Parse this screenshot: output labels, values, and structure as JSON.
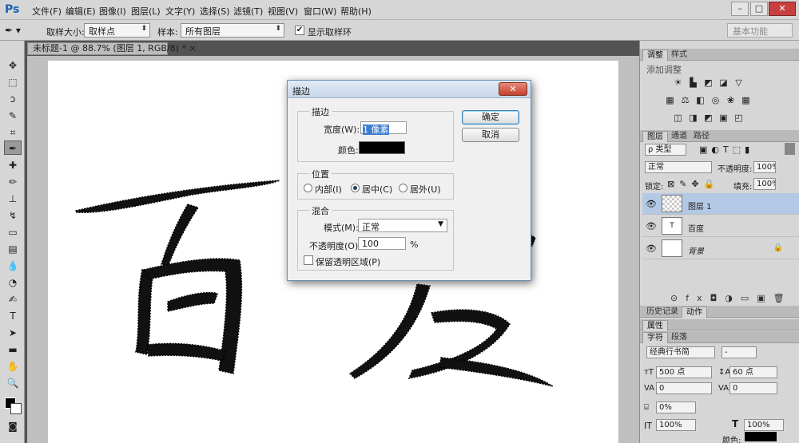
{
  "app": {
    "logo": "Ps"
  },
  "menu": [
    "文件(F)",
    "编辑(E)",
    "图像(I)",
    "图层(L)",
    "文字(Y)",
    "选择(S)",
    "滤镜(T)",
    "视图(V)",
    "窗口(W)",
    "帮助(H)"
  ],
  "window_controls": {
    "minimize": "–",
    "maximize": "□",
    "close": "✕"
  },
  "options": {
    "sample_size_label": "取样大小:",
    "sample_size_value": "取样点",
    "sample_label": "样本:",
    "sample_value": "所有图层",
    "show_ring_label": "显示取样环",
    "show_ring_checked": "✔",
    "workspace": "基本功能"
  },
  "document": {
    "tab": "未标题-1 @ 88.7% (图层 1, RGB/8) *",
    "tab_close": "×"
  },
  "dialog": {
    "title": "描边",
    "close": "✕",
    "stroke_group": "描边",
    "width_label": "宽度(W):",
    "width_value": "1 像素",
    "color_label": "颜色:",
    "color_value": "#000000",
    "position_group": "位置",
    "inside": "内部(I)",
    "center": "居中(C)",
    "outside": "居外(U)",
    "blend_group": "混合",
    "mode_label": "模式(M):",
    "mode_value": "正常",
    "opacity_label": "不透明度(O):",
    "opacity_value": "100",
    "opacity_unit": "%",
    "preserve_label": "保留透明区域(P)",
    "ok": "确定",
    "cancel": "取消"
  },
  "panels": {
    "tab_adjust": "调整",
    "tab_style": "样式",
    "adjust_title": "添加调整",
    "tab_layers": "图层",
    "tab_channels": "通道",
    "tab_paths": "路径",
    "filter_kind": "ρ 类型",
    "blend_mode": "正常",
    "opacity_label": "不透明度:",
    "opacity_value": "100%",
    "lock_label": "锁定:",
    "fill_label": "填充:",
    "fill_value": "100%",
    "layers": [
      {
        "name": "图层 1",
        "selected": true
      },
      {
        "name": "百度",
        "selected": false
      },
      {
        "name": "背景",
        "selected": false
      }
    ],
    "tab_history": "历史记录",
    "tab_actions": "动作",
    "properties_tab": "属性",
    "tab_character": "字符",
    "tab_paragraph": "段落",
    "font_family": "经典行书简",
    "font_style": "-",
    "font_size": "500 点",
    "leading": "60 点",
    "kerning": "0",
    "tracking": "0",
    "scale_pct": "0%",
    "vscale": "100%",
    "hscale": "100%",
    "color_label": "颜色:"
  }
}
